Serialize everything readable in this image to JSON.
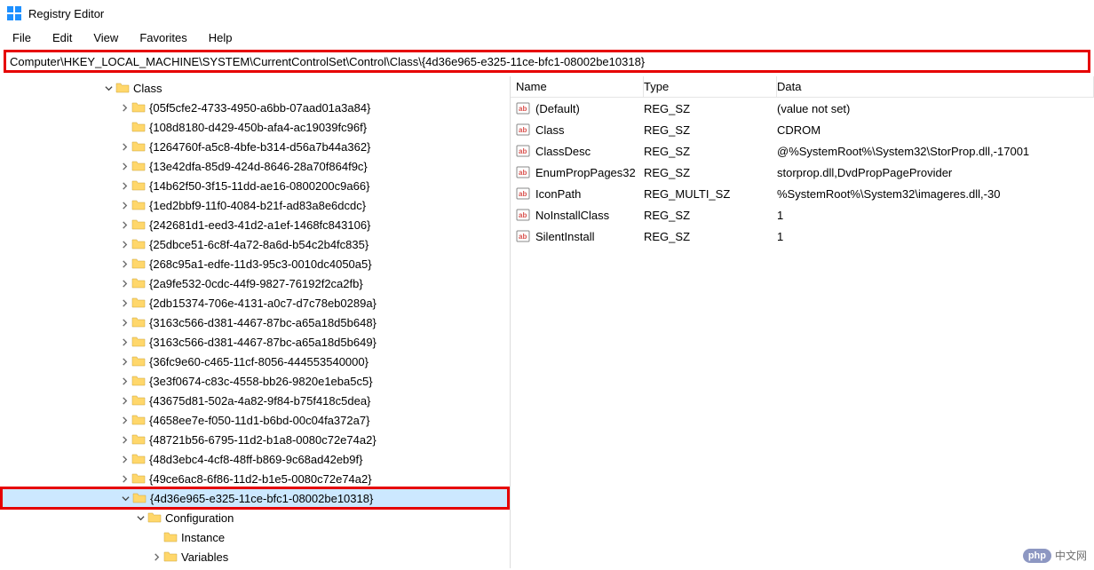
{
  "app": {
    "title": "Registry Editor"
  },
  "menu": [
    "File",
    "Edit",
    "View",
    "Favorites",
    "Help"
  ],
  "address": "Computer\\HKEY_LOCAL_MACHINE\\SYSTEM\\CurrentControlSet\\Control\\Class\\{4d36e965-e325-11ce-bfc1-08002be10318}",
  "tree": {
    "root_label": "Class",
    "items": [
      "{05f5cfe2-4733-4950-a6bb-07aad01a3a84}",
      "{108d8180-d429-450b-afa4-ac19039fc96f}",
      "{1264760f-a5c8-4bfe-b314-d56a7b44a362}",
      "{13e42dfa-85d9-424d-8646-28a70f864f9c}",
      "{14b62f50-3f15-11dd-ae16-0800200c9a66}",
      "{1ed2bbf9-11f0-4084-b21f-ad83a8e6dcdc}",
      "{242681d1-eed3-41d2-a1ef-1468fc843106}",
      "{25dbce51-6c8f-4a72-8a6d-b54c2b4fc835}",
      "{268c95a1-edfe-11d3-95c3-0010dc4050a5}",
      "{2a9fe532-0cdc-44f9-9827-76192f2ca2fb}",
      "{2db15374-706e-4131-a0c7-d7c78eb0289a}",
      "{3163c566-d381-4467-87bc-a65a18d5b648}",
      "{3163c566-d381-4467-87bc-a65a18d5b649}",
      "{36fc9e60-c465-11cf-8056-444553540000}",
      "{3e3f0674-c83c-4558-bb26-9820e1eba5c5}",
      "{43675d81-502a-4a82-9f84-b75f418c5dea}",
      "{4658ee7e-f050-11d1-b6bd-00c04fa372a7}",
      "{48721b56-6795-11d2-b1a8-0080c72e74a2}",
      "{48d3ebc4-4cf8-48ff-b869-9c68ad42eb9f}",
      "{49ce6ac8-6f86-11d2-b1e5-0080c72e74a2}"
    ],
    "selected": "{4d36e965-e325-11ce-bfc1-08002be10318}",
    "child": {
      "label": "Configuration",
      "children": [
        "Instance",
        "Variables"
      ]
    }
  },
  "list": {
    "headers": {
      "name": "Name",
      "type": "Type",
      "data": "Data"
    },
    "rows": [
      {
        "name": "(Default)",
        "type": "REG_SZ",
        "data": "(value not set)"
      },
      {
        "name": "Class",
        "type": "REG_SZ",
        "data": "CDROM"
      },
      {
        "name": "ClassDesc",
        "type": "REG_SZ",
        "data": "@%SystemRoot%\\System32\\StorProp.dll,-17001"
      },
      {
        "name": "EnumPropPages32",
        "type": "REG_SZ",
        "data": "storprop.dll,DvdPropPageProvider"
      },
      {
        "name": "IconPath",
        "type": "REG_MULTI_SZ",
        "data": "%SystemRoot%\\System32\\imageres.dll,-30"
      },
      {
        "name": "NoInstallClass",
        "type": "REG_SZ",
        "data": "1"
      },
      {
        "name": "SilentInstall",
        "type": "REG_SZ",
        "data": "1"
      }
    ]
  },
  "watermark": {
    "brand": "php",
    "text": "中文网"
  }
}
